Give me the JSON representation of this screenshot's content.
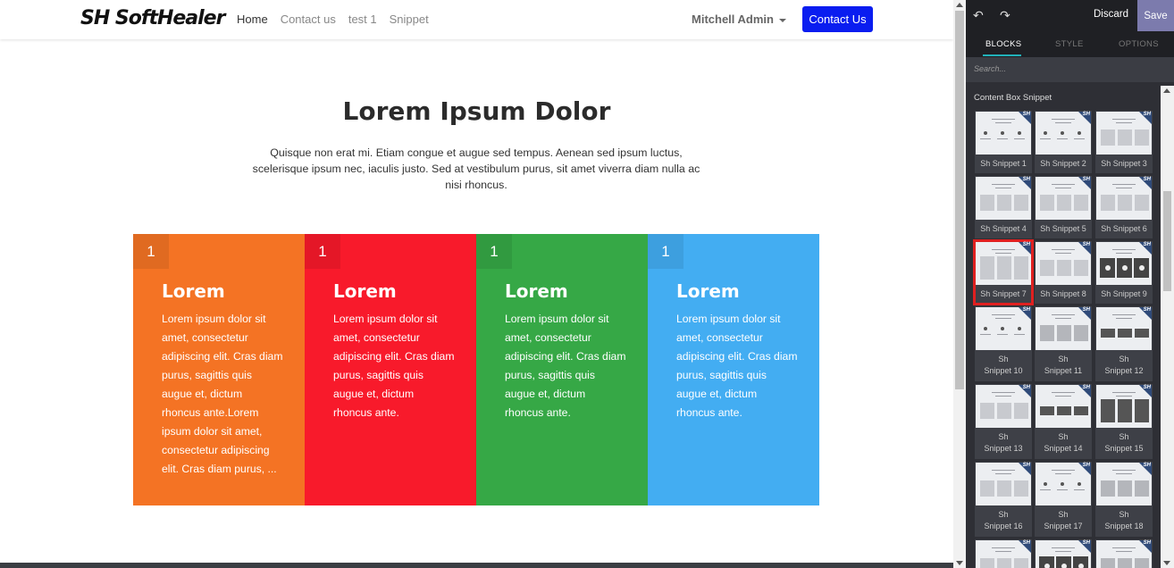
{
  "navbar": {
    "logo_text": "SH SoftHealer",
    "links": [
      {
        "label": "Home",
        "active": true
      },
      {
        "label": "Contact us",
        "active": false
      },
      {
        "label": "test 1",
        "active": false
      },
      {
        "label": "Snippet",
        "active": false
      }
    ],
    "user": "Mitchell Admin",
    "cta_label": "Contact Us"
  },
  "hero": {
    "title": "Lorem Ipsum Dolor",
    "text": "Quisque non erat mi. Etiam congue et augue sed tempus. Aenean sed ipsum luctus, scelerisque ipsum nec, iaculis justo. Sed at vestibulum purus, sit amet viverra diam nulla ac nisi rhoncus."
  },
  "boxes": [
    {
      "number": "1",
      "title": "Lorem",
      "text": "Lorem ipsum dolor sit amet, consectetur adipiscing elit. Cras diam purus, sagittis quis augue et, dictum rhoncus ante.Lorem ipsum dolor sit amet, consectetur adipiscing elit. Cras diam purus, ...",
      "color": "#f47324"
    },
    {
      "number": "1",
      "title": "Lorem",
      "text": "Lorem ipsum dolor sit amet, consectetur adipiscing elit. Cras diam purus, sagittis quis augue et, dictum rhoncus ante.",
      "color": "#f81a2b"
    },
    {
      "number": "1",
      "title": "Lorem",
      "text": "Lorem ipsum dolor sit amet, consectetur adipiscing elit. Cras diam purus, sagittis quis augue et, dictum rhoncus ante.",
      "color": "#36a846"
    },
    {
      "number": "1",
      "title": "Lorem",
      "text": "Lorem ipsum dolor sit amet, consectetur adipiscing elit. Cras diam purus, sagittis quis augue et, dictum rhoncus ante.",
      "color": "#43adf2"
    }
  ],
  "editor": {
    "undo_icon": "↶",
    "redo_icon": "↷",
    "discard_label": "Discard",
    "save_label": "Save",
    "tabs": [
      "BLOCKS",
      "STYLE",
      "OPTIONS"
    ],
    "active_tab": "BLOCKS",
    "search_placeholder": "Search...",
    "section_title": "Content Box Snippet",
    "thumb_tag": "SH",
    "snippets": [
      {
        "label": "Sh Snippet 1"
      },
      {
        "label": "Sh Snippet 2"
      },
      {
        "label": "Sh Snippet 3"
      },
      {
        "label": "Sh Snippet 4"
      },
      {
        "label": "Sh Snippet 5"
      },
      {
        "label": "Sh Snippet 6"
      },
      {
        "label": "Sh Snippet 7",
        "selected": true
      },
      {
        "label": "Sh Snippet 8"
      },
      {
        "label": "Sh Snippet 9"
      },
      {
        "label": "Sh Snippet 10"
      },
      {
        "label": "Sh Snippet 11"
      },
      {
        "label": "Sh Snippet 12"
      },
      {
        "label": "Sh Snippet 13"
      },
      {
        "label": "Sh Snippet 14"
      },
      {
        "label": "Sh Snippet 15"
      },
      {
        "label": "Sh Snippet 16"
      },
      {
        "label": "Sh Snippet 17"
      },
      {
        "label": "Sh Snippet 18"
      },
      {
        "label": ""
      },
      {
        "label": ""
      },
      {
        "label": ""
      }
    ]
  }
}
